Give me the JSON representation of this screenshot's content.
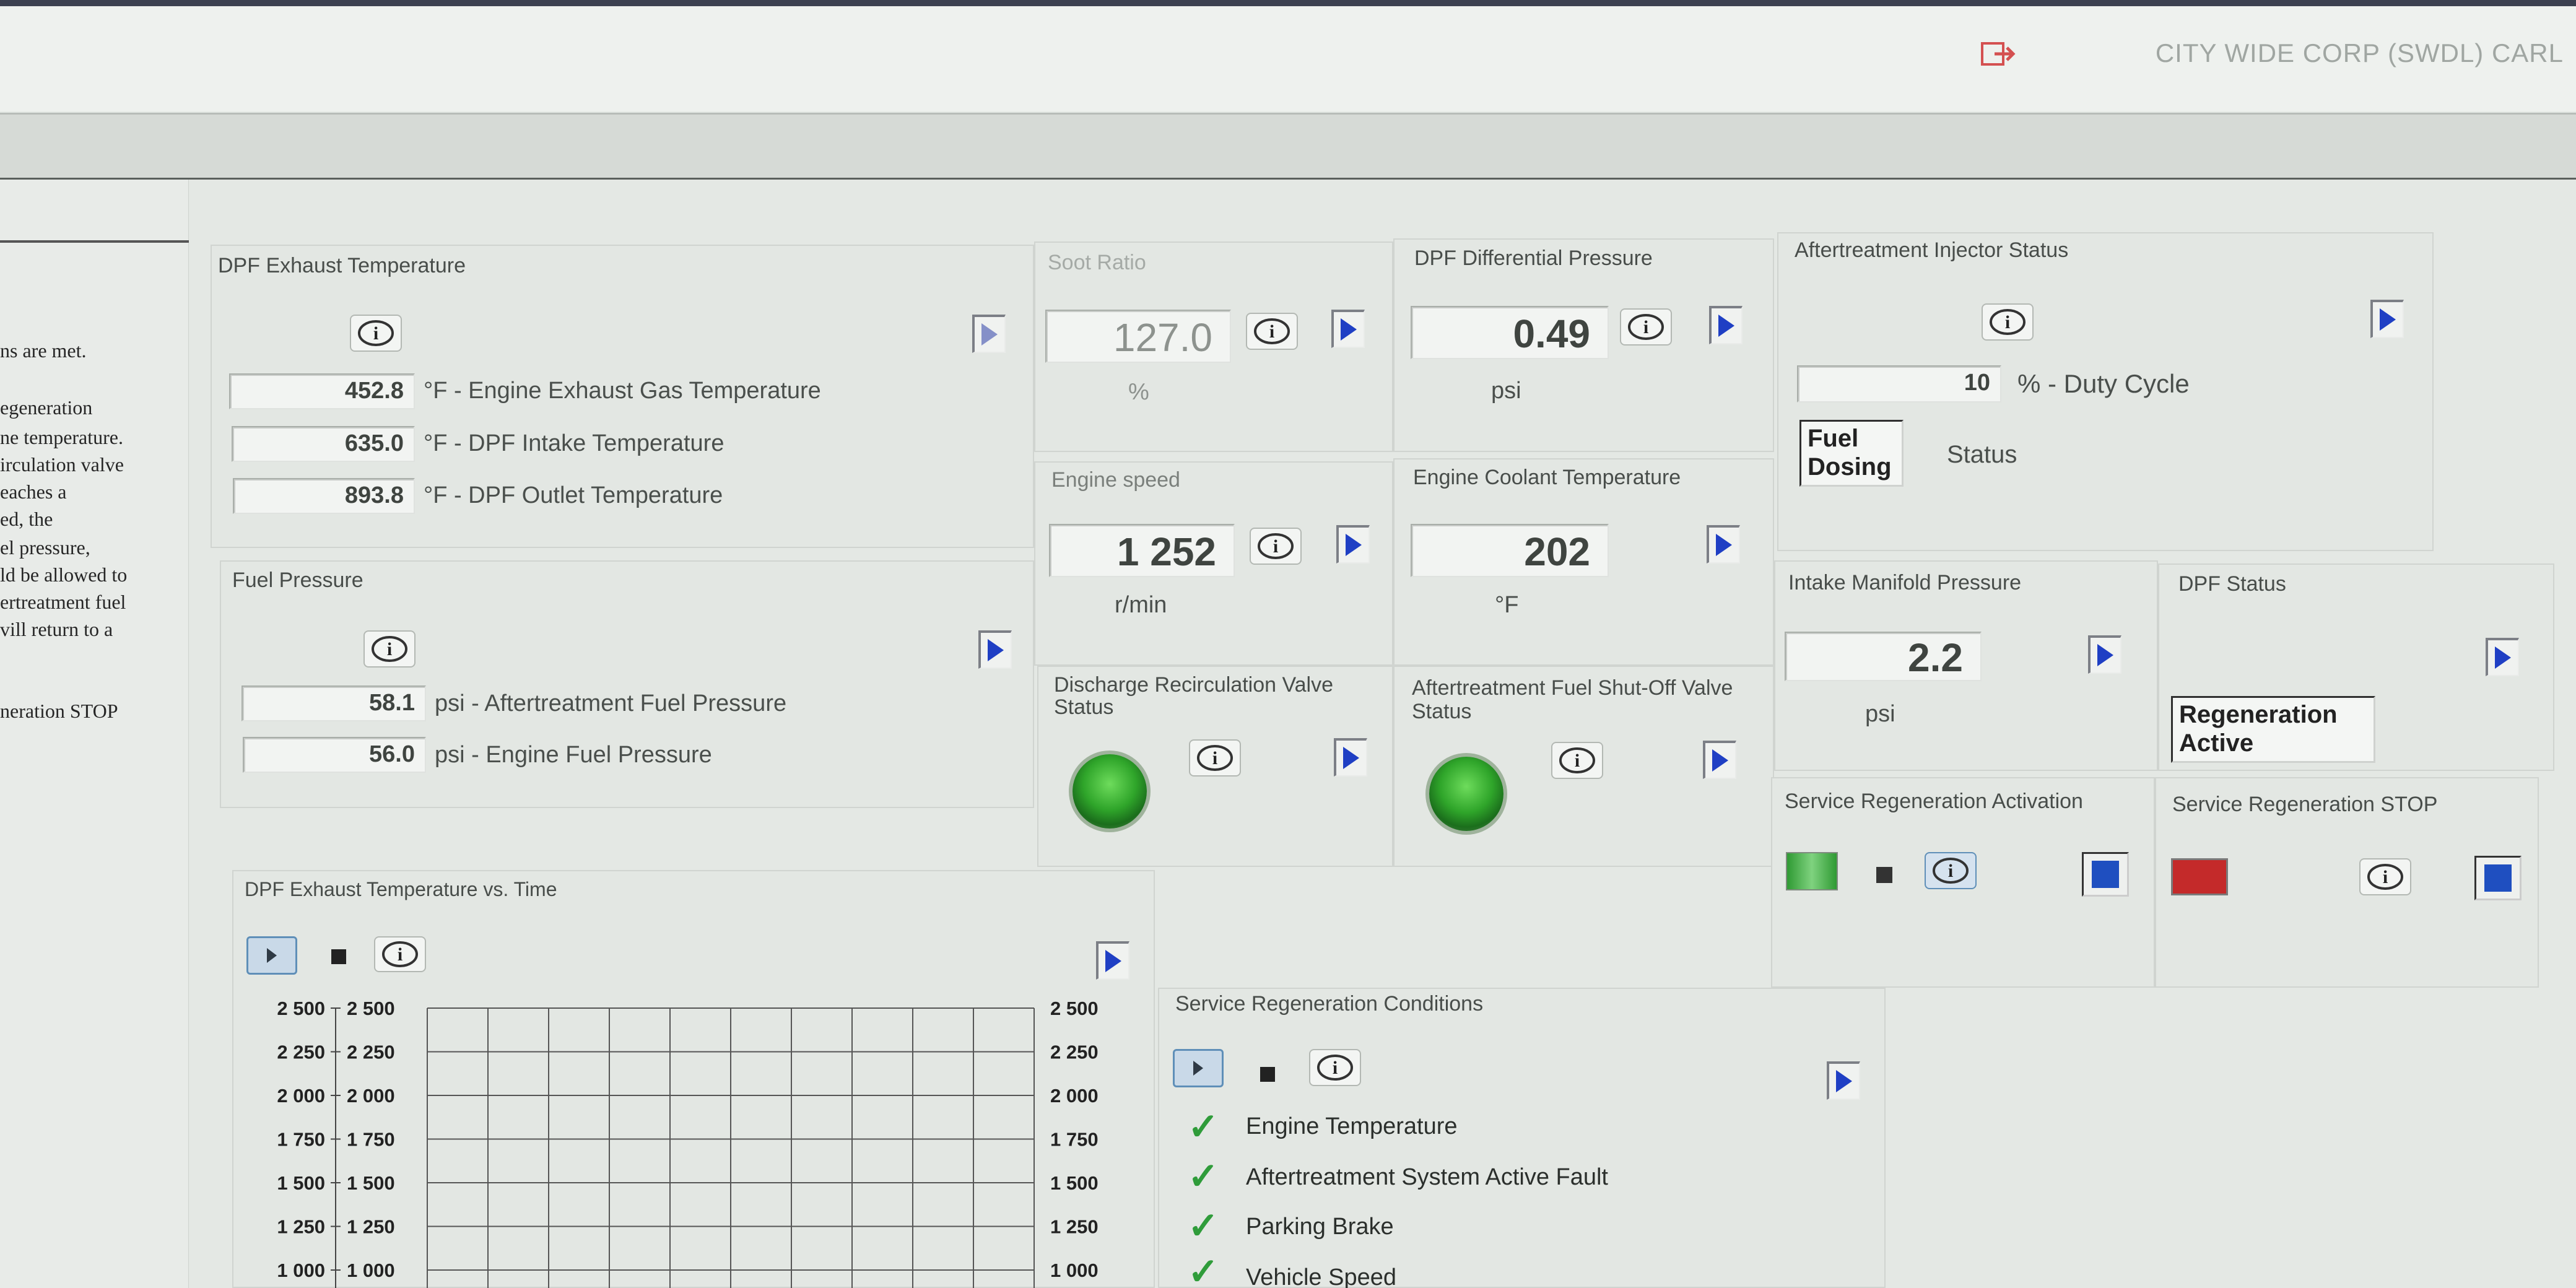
{
  "header": {
    "account": "CITY WIDE CORP (SWDL) CARL",
    "logout_icon": "logout-icon"
  },
  "left_text": [
    "ns are met.",
    "egeneration",
    "ne temperature.",
    "irculation valve",
    "eaches a",
    "ed, the",
    "el pressure,",
    "ld be allowed to",
    "ertreatment fuel",
    "vill return to a",
    "neration STOP"
  ],
  "dpf_exhaust": {
    "title": "DPF Exhaust Temperature",
    "rows": [
      {
        "value": "452.8",
        "label": "°F - Engine Exhaust Gas Temperature"
      },
      {
        "value": "635.0",
        "label": "°F - DPF Intake Temperature"
      },
      {
        "value": "893.8",
        "label": "°F - DPF Outlet Temperature"
      }
    ]
  },
  "fuel_pressure": {
    "title": "Fuel Pressure",
    "rows": [
      {
        "value": "58.1",
        "label": "psi - Aftertreatment Fuel Pressure"
      },
      {
        "value": "56.0",
        "label": "psi - Engine Fuel Pressure"
      }
    ]
  },
  "soot_ratio": {
    "title": "Soot Ratio",
    "value": "127.0",
    "unit": "%"
  },
  "dpf_diff": {
    "title": "DPF Differential Pressure",
    "value": "0.49",
    "unit": "psi"
  },
  "engine_speed": {
    "title": "Engine speed",
    "value": "1 252",
    "unit": "r/min"
  },
  "coolant": {
    "title": "Engine Coolant Temperature",
    "value": "202",
    "unit": "°F"
  },
  "discharge_valve": {
    "title": "Discharge Recirculation Valve Status",
    "state": "on",
    "color": "#3cc03a"
  },
  "fuel_shutoff": {
    "title": "Aftertreatment Fuel Shut-Off Valve Status",
    "state": "on",
    "color": "#3cc03a"
  },
  "injector": {
    "title": "Aftertreatment Injector Status",
    "value": "10",
    "unit": "% - Duty Cycle",
    "status_box": "Fuel Dosing",
    "status_label": "Status"
  },
  "intake_manifold": {
    "title": "Intake Manifold Pressure",
    "value": "2.2",
    "unit": "psi"
  },
  "dpf_status": {
    "title": "DPF Status",
    "status_box": "Regeneration Active"
  },
  "regen_activation": {
    "title": "Service Regeneration Activation",
    "indicator_color": "#3aa33a"
  },
  "regen_stop": {
    "title": "Service Regeneration STOP",
    "indicator_color": "#cc2a2a"
  },
  "chart_title": "DPF Exhaust Temperature vs. Time",
  "chart_data": {
    "type": "line",
    "title": "",
    "xlabel": "",
    "ylabel": "",
    "y_ticks": [
      "2 500",
      "2 250",
      "2 000",
      "1 750",
      "1 500",
      "1 250",
      "1 000"
    ],
    "ylim": [
      1000,
      2500
    ],
    "grid": true,
    "series": []
  },
  "conditions": {
    "title": "Service Regeneration Conditions",
    "items": [
      "Engine Temperature",
      "Aftertreatment System Active Fault",
      "Parking Brake",
      "Vehicle Speed"
    ]
  }
}
